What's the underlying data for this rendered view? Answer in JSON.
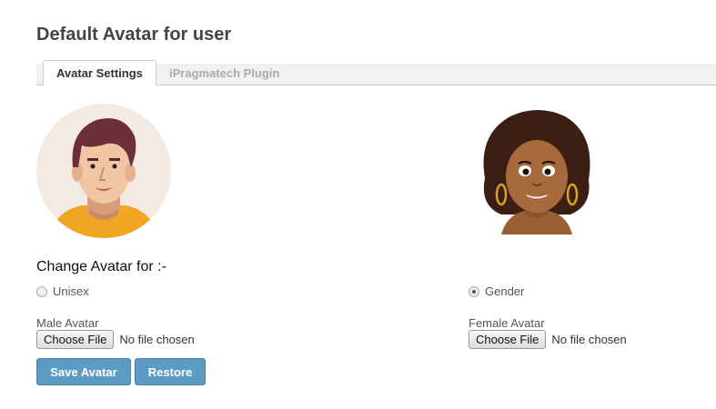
{
  "page": {
    "title": "Default Avatar for user"
  },
  "tabs": [
    {
      "label": "Avatar Settings",
      "active": true
    },
    {
      "label": "iPragmatech Plugin",
      "active": false
    }
  ],
  "avatars": {
    "male": {
      "icon": "male-avatar-illustration"
    },
    "female": {
      "icon": "female-avatar-illustration"
    }
  },
  "change_avatar": {
    "heading": "Change Avatar for :-",
    "options": [
      {
        "label": "Unisex",
        "checked": false
      },
      {
        "label": "Gender",
        "checked": true
      }
    ]
  },
  "uploads": {
    "male": {
      "label": "Male Avatar",
      "button": "Choose File",
      "status": "No file chosen"
    },
    "female": {
      "label": "Female Avatar",
      "button": "Choose File",
      "status": "No file chosen"
    }
  },
  "actions": {
    "save": "Save Avatar",
    "restore": "Restore"
  },
  "colors": {
    "button": "#5b9bc4",
    "title": "#444444",
    "tab_inactive": "#aaaaaa"
  }
}
